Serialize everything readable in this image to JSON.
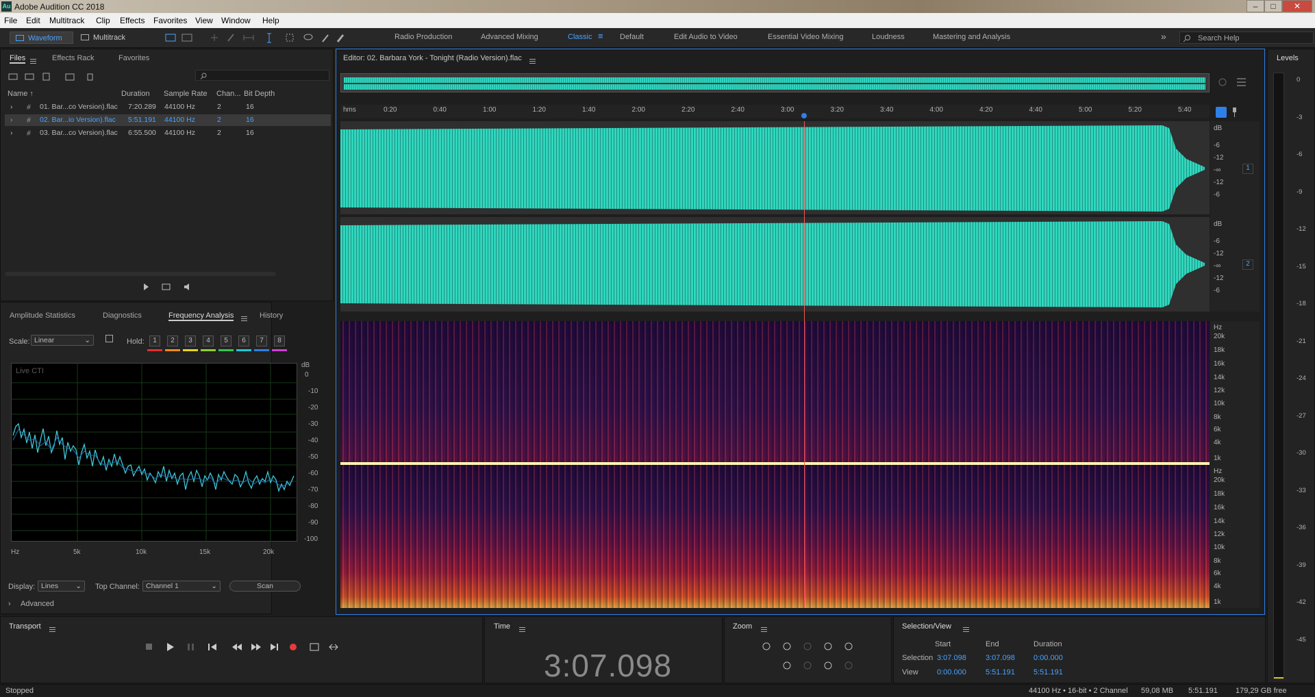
{
  "window": {
    "title": "Adobe Audition CC 2018",
    "app_icon_text": "Au",
    "min": "–",
    "max": "□",
    "close": "✕"
  },
  "menu": [
    "File",
    "Edit",
    "Multitrack",
    "Clip",
    "Effects",
    "Favorites",
    "View",
    "Window",
    "Help"
  ],
  "toolbar": {
    "waveform": "Waveform",
    "multitrack": "Multitrack",
    "workspaces": [
      "Radio Production",
      "Advanced Mixing",
      "Classic",
      "Default",
      "Edit Audio to Video",
      "Essential Video Mixing",
      "Loudness",
      "Mastering and Analysis"
    ],
    "active_workspace": "Classic",
    "search_placeholder": "Search Help",
    "more": "»"
  },
  "files_panel": {
    "tabs": [
      "Files",
      "Effects Rack",
      "Favorites"
    ],
    "columns": [
      "Name ↑",
      "Duration",
      "Sample Rate",
      "Chan...",
      "Bit Depth"
    ],
    "rows": [
      {
        "name": "01. Bar...co Version).flac",
        "duration": "7:20.289",
        "rate": "44100 Hz",
        "channels": "2",
        "bits": "16",
        "selected": false
      },
      {
        "name": "02. Bar...io Version).flac",
        "duration": "5:51.191",
        "rate": "44100 Hz",
        "channels": "2",
        "bits": "16",
        "selected": true
      },
      {
        "name": "03. Bar...co Version).flac",
        "duration": "6:55.500",
        "rate": "44100 Hz",
        "channels": "2",
        "bits": "16",
        "selected": false
      }
    ]
  },
  "analysis_panel": {
    "tabs": [
      "Amplitude Statistics",
      "Diagnostics",
      "Frequency Analysis",
      "History"
    ],
    "scale_label": "Scale:",
    "scale_value": "Linear",
    "hold_label": "Hold:",
    "hold_buttons": [
      "1",
      "2",
      "3",
      "4",
      "5",
      "6",
      "7",
      "8"
    ],
    "hold_colors": [
      "#e03030",
      "#f08a1c",
      "#e6d51a",
      "#8fd12a",
      "#2fc84f",
      "#1cc6d8",
      "#2f7fe8",
      "#d23ad8"
    ],
    "live_label": "Live CTI",
    "y_unit": "dB",
    "y_ticks": [
      "0",
      "-10",
      "-20",
      "-30",
      "-40",
      "-50",
      "-60",
      "-70",
      "-80",
      "-90",
      "-100"
    ],
    "x_ticks": [
      "Hz",
      "5k",
      "10k",
      "15k",
      "20k"
    ],
    "display_label": "Display:",
    "display_value": "Lines",
    "top_channel_label": "Top Channel:",
    "top_channel_value": "Channel 1",
    "scan_label": "Scan",
    "advanced_label": "Advanced"
  },
  "editor": {
    "title": "Editor: 02. Barbara York - Tonight (Radio Version).flac",
    "time_unit": "hms",
    "time_ticks": [
      "0:20",
      "0:40",
      "1:00",
      "1:20",
      "1:40",
      "2:00",
      "2:20",
      "2:40",
      "3:00",
      "3:20",
      "3:40",
      "4:00",
      "4:20",
      "4:40",
      "5:00",
      "5:20",
      "5:40"
    ],
    "db_scale": [
      "dB",
      "-6",
      "-12",
      "-∞",
      "-12",
      "-6"
    ],
    "channel_badges": [
      "1",
      "2"
    ],
    "hz_scale": [
      "Hz",
      "20k",
      "18k",
      "16k",
      "14k",
      "12k",
      "10k",
      "8k",
      "6k",
      "4k",
      "1k"
    ]
  },
  "levels": {
    "title": "Levels",
    "ticks": [
      "0",
      "-3",
      "-6",
      "-9",
      "-12",
      "-15",
      "-18",
      "-21",
      "-24",
      "-27",
      "-30",
      "-33",
      "-36",
      "-39",
      "-42",
      "-45"
    ]
  },
  "transport": {
    "title": "Transport"
  },
  "time_panel": {
    "title": "Time",
    "value": "3:07.098"
  },
  "zoom_panel": {
    "title": "Zoom"
  },
  "selection": {
    "title": "Selection/View",
    "headers": [
      "Start",
      "End",
      "Duration"
    ],
    "rows": [
      {
        "label": "Selection",
        "start": "3:07.098",
        "end": "3:07.098",
        "duration": "0:00.000"
      },
      {
        "label": "View",
        "start": "0:00.000",
        "end": "5:51.191",
        "duration": "5:51.191"
      }
    ]
  },
  "status": {
    "state": "Stopped",
    "format": "44100 Hz • 16-bit • 2 Channel",
    "size": "59,08 MB",
    "duration": "5:51.191",
    "free": "179,29 GB free"
  }
}
